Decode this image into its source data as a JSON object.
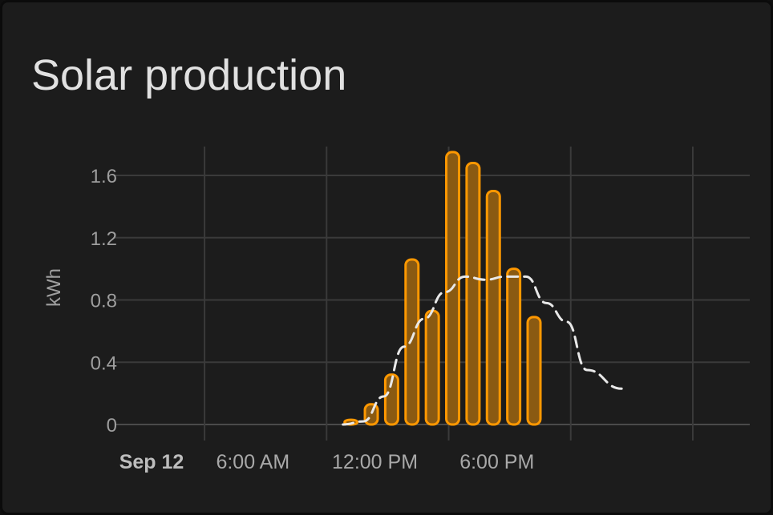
{
  "card": {
    "title": "Solar production"
  },
  "chart_data": {
    "type": "bar",
    "ylabel": "kWh",
    "ylim": [
      0,
      1.8
    ],
    "y_ticks": [
      0,
      0.4,
      0.8,
      1.2,
      1.6
    ],
    "y_tick_labels": [
      "0",
      "0.4",
      "0.8",
      "1.2",
      "1.6"
    ],
    "x_tick_labels": [
      "Sep 12",
      "6:00 AM",
      "12:00 PM",
      "6:00 PM"
    ],
    "x_tick_hours": [
      0,
      6,
      12,
      18
    ],
    "x_range_hours": [
      -4.3,
      26.8
    ],
    "grid": true,
    "series": [
      {
        "kind": "bar",
        "color": "#ff9800",
        "hours": [
          7,
          8,
          9,
          10,
          11,
          12,
          13,
          14,
          15,
          16
        ],
        "values": [
          0.03,
          0.13,
          0.32,
          1.06,
          0.73,
          1.75,
          1.68,
          1.5,
          1.0,
          0.69
        ]
      },
      {
        "kind": "line",
        "style": "dashed",
        "color": "#e8e8e8",
        "hours": [
          7,
          8,
          9,
          10,
          11,
          12,
          13,
          14,
          15,
          16,
          17,
          18,
          19
        ],
        "values": [
          0.0,
          0.02,
          0.18,
          0.5,
          0.68,
          0.85,
          0.95,
          0.93,
          0.95,
          0.95,
          0.78,
          0.66,
          0.35
        ],
        "end_hour": 20.5,
        "end_value": 0.23
      }
    ]
  }
}
